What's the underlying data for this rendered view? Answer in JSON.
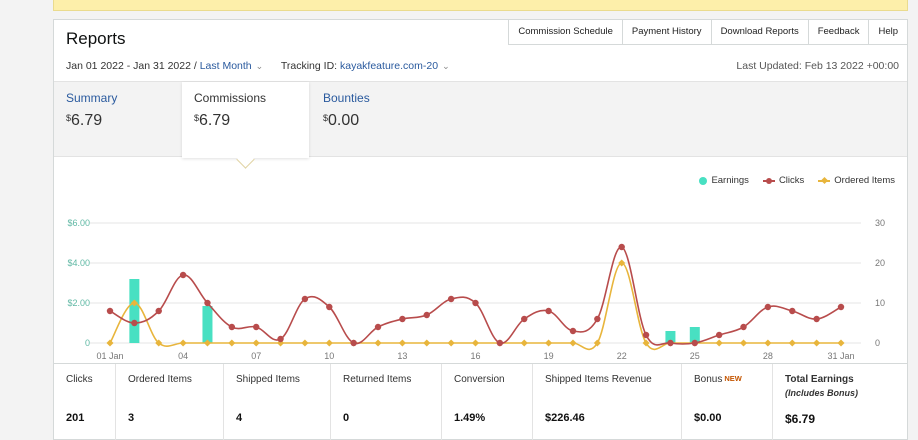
{
  "header": {
    "title": "Reports",
    "tabs": [
      "Commission Schedule",
      "Payment History",
      "Download Reports",
      "Feedback",
      "Help"
    ],
    "date_range": "Jan 01 2022 - Jan 31 2022 /",
    "range_preset": "Last Month",
    "tracking_label": "Tracking ID:",
    "tracking_id": "kayakfeature.com-20",
    "last_updated": "Last Updated: Feb 13 2022 +00:00"
  },
  "summary_tabs": [
    {
      "label": "Summary",
      "currency": "$",
      "amount": "6.79",
      "active": false
    },
    {
      "label": "Commissions",
      "currency": "$",
      "amount": "6.79",
      "active": true
    },
    {
      "label": "Bounties",
      "currency": "$",
      "amount": "0.00",
      "active": false
    }
  ],
  "legend": {
    "earnings": "Earnings",
    "clicks": "Clicks",
    "ordered": "Ordered Items"
  },
  "colors": {
    "earnings": "#48e0c2",
    "clicks": "#b84c4c",
    "ordered": "#e8b53c",
    "link": "#2a5a9e"
  },
  "chart_data": {
    "type": "bar+line",
    "x_tick_labels": [
      "01 Jan",
      "04",
      "07",
      "10",
      "13",
      "16",
      "19",
      "22",
      "25",
      "28",
      "31 Jan"
    ],
    "left_axis_ticks": [
      "$6.00",
      "$4.00",
      "$2.00",
      "0"
    ],
    "right_axis_ticks": [
      "30",
      "20",
      "10",
      "0"
    ],
    "left_ylim": [
      0,
      6
    ],
    "right_ylim": [
      0,
      30
    ],
    "days": [
      1,
      2,
      3,
      4,
      5,
      6,
      7,
      8,
      9,
      10,
      11,
      12,
      13,
      14,
      15,
      16,
      17,
      18,
      19,
      20,
      21,
      22,
      23,
      24,
      25,
      26,
      27,
      28,
      29,
      30,
      31
    ],
    "series": [
      {
        "name": "Earnings",
        "axis": "left",
        "type": "bar",
        "values": [
          0,
          3.2,
          0,
          0,
          1.85,
          0,
          0,
          0,
          0,
          0,
          0,
          0,
          0,
          0,
          0,
          0,
          0,
          0,
          0,
          0,
          0,
          0,
          0,
          0.6,
          0.8,
          0,
          0,
          0,
          0,
          0,
          0
        ]
      },
      {
        "name": "Clicks",
        "axis": "right",
        "type": "line",
        "values": [
          8,
          5,
          8,
          17,
          10,
          4,
          4,
          1,
          11,
          9,
          0,
          4,
          6,
          7,
          11,
          10,
          0,
          6,
          8,
          3,
          6,
          24,
          2,
          0,
          0,
          2,
          4,
          9,
          8,
          6,
          9
        ]
      },
      {
        "name": "Ordered Items",
        "axis": "right",
        "type": "line",
        "values": [
          0,
          10,
          0,
          0,
          0,
          0,
          0,
          0,
          0,
          0,
          0,
          0,
          0,
          0,
          0,
          0,
          0,
          0,
          0,
          0,
          0,
          20,
          0,
          0,
          0,
          0,
          0,
          0,
          0,
          0,
          0
        ]
      }
    ],
    "grid": true,
    "legend_position": "top-right"
  },
  "stats": [
    {
      "label": "Clicks",
      "value": "201"
    },
    {
      "label": "Ordered Items",
      "value": "3"
    },
    {
      "label": "Shipped Items",
      "value": "4"
    },
    {
      "label": "Returned Items",
      "value": "0"
    },
    {
      "label": "Conversion",
      "value": "1.49%"
    },
    {
      "label": "Shipped Items Revenue",
      "value": "$226.46"
    },
    {
      "label": "Bonus",
      "badge": "NEW",
      "value": "$0.00"
    },
    {
      "label": "Total Earnings",
      "sublabel": "(Includes Bonus)",
      "value": "$6.79"
    }
  ]
}
